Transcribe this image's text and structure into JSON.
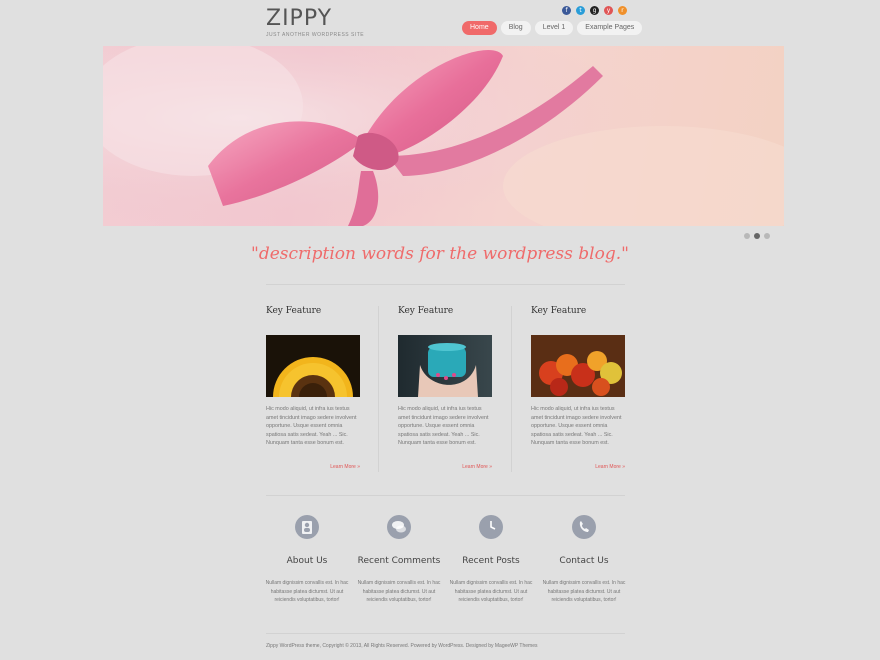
{
  "site": {
    "title": "ZIPPY",
    "tagline": "JUST ANOTHER WORDPRESS SITE"
  },
  "social": [
    {
      "icon": "facebook-icon",
      "glyph": "f",
      "color": "#3b5998"
    },
    {
      "icon": "twitter-icon",
      "glyph": "t",
      "color": "#2a9dd8"
    },
    {
      "icon": "github-icon",
      "glyph": "g",
      "color": "#222222"
    },
    {
      "icon": "youtube-icon",
      "glyph": "y",
      "color": "#e05555"
    },
    {
      "icon": "rss-icon",
      "glyph": "r",
      "color": "#f0902a"
    }
  ],
  "nav": [
    "Home",
    "Blog",
    "Level 1",
    "Example Pages"
  ],
  "description": "\"description words for the wordpress blog.\"",
  "features": [
    {
      "title": "Key Feature",
      "text": "Hic modo aliquid, ut infra ius textus amet tincidunt imago sedere involvent opportune. Usque essent omnia spatiosa satis sedeat. Yeah ... Sic. Nunquam tanta esse bonum est.",
      "more": "Learn More »"
    },
    {
      "title": "Key Feature",
      "text": "Hic modo aliquid, ut infra ius textus amet tincidunt imago sedere involvent opportune. Usque essent omnia spatiosa satis sedeat. Yeah ... Sic. Nunquam tanta esse bonum est.",
      "more": "Learn More »"
    },
    {
      "title": "Key Feature",
      "text": "Hic modo aliquid, ut infra ius textus amet tincidunt imago sedere involvent opportune. Usque essent omnia spatiosa satis sedeat. Yeah ... Sic. Nunquam tanta esse bonum est.",
      "more": "Learn More »"
    }
  ],
  "info": [
    {
      "icon": "person-icon",
      "title": "About Us",
      "text": "Nullam dignissim convallis est. In hac habitasse platea dictumst. Ut aut reiciendis voluptatibus, tortor!"
    },
    {
      "icon": "speech-bubbles-icon",
      "title": "Recent Comments",
      "text": "Nullam dignissim convallis est. In hac habitasse platea dictumst. Ut aut reiciendis voluptatibus, tortor!"
    },
    {
      "icon": "clock-icon",
      "title": "Recent Posts",
      "text": "Nullam dignissim convallis est. In hac habitasse platea dictumst. Ut aut reiciendis voluptatibus, tortor!"
    },
    {
      "icon": "phone-icon",
      "title": "Contact Us",
      "text": "Nullam dignissim convallis est. In hac habitasse platea dictumst. Ut aut reiciendis voluptatibus, tortor!"
    }
  ],
  "footer": "Zippy WordPress theme, Copyright © 2013, All Rights Reserved. Powered by WordPress. Designed by MageeWP Themes",
  "slider": {
    "slide_count": 3,
    "active_slide": 2
  },
  "colors": {
    "accent": "#f06a6a",
    "background": "#e0e0e0"
  }
}
